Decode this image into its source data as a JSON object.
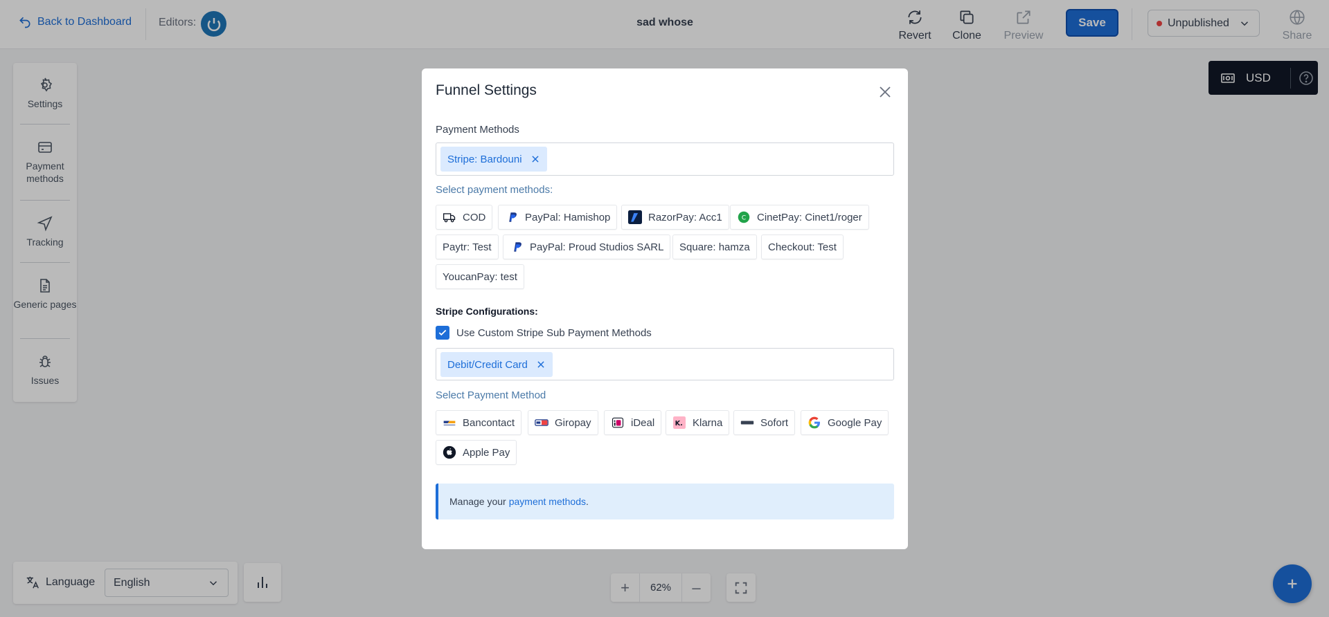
{
  "topbar": {
    "back_label": "Back to Dashboard",
    "editors_label": "Editors:",
    "page_title": "sad whose",
    "tools": {
      "revert": "Revert",
      "clone": "Clone",
      "preview": "Preview",
      "share": "Share"
    },
    "save_label": "Save",
    "status": "Unpublished"
  },
  "sidebar": {
    "items": [
      {
        "label": "Settings",
        "icon": "gear-icon"
      },
      {
        "label": "Payment methods",
        "icon": "credit-card-icon"
      },
      {
        "label": "Tracking",
        "icon": "navigation-icon"
      },
      {
        "label": "Generic pages",
        "icon": "document-icon"
      },
      {
        "label": "Issues",
        "icon": "bug-icon"
      }
    ]
  },
  "currency": {
    "label": "USD"
  },
  "language": {
    "label": "Language",
    "selected": "English"
  },
  "zoom": {
    "value": "62%"
  },
  "modal": {
    "title": "Funnel Settings",
    "payment_methods_label": "Payment Methods",
    "selected_payment_tag": "Stripe: Bardouni",
    "select_payment_methods_label": "Select payment methods:",
    "payment_options": [
      "COD",
      "PayPal: Hamishop",
      "RazorPay: Acc1",
      "CinetPay: Cinet1/roger",
      "Paytr: Test",
      "PayPal: Proud Studios SARL",
      "Square: hamza",
      "Checkout: Test",
      "YoucanPay: test"
    ],
    "stripe_config_label": "Stripe Configurations:",
    "custom_stripe_checkbox_label": "Use Custom Stripe Sub Payment Methods",
    "custom_stripe_checked": true,
    "selected_sub_method_tag": "Debit/Credit Card",
    "select_payment_method_label": "Select Payment Method",
    "sub_method_options": [
      "Bancontact",
      "Giropay",
      "iDeal",
      "Klarna",
      "Sofort",
      "Google Pay",
      "Apple Pay"
    ],
    "notice_prefix": "Manage your",
    "notice_link": "payment methods",
    "notice_suffix": "."
  }
}
